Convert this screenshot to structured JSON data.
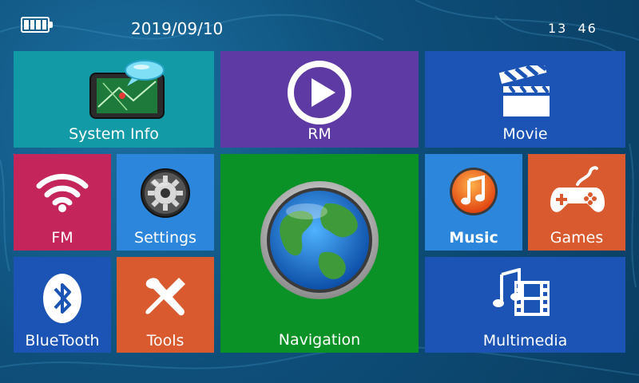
{
  "status_bar": {
    "date": "2019/09/10",
    "time": "13 46",
    "battery_icon": "battery-full-icon"
  },
  "tiles": {
    "system_info": {
      "label": "System Info",
      "icon": "gps-device-icon",
      "color": "#139aa7"
    },
    "rm": {
      "label": "RM",
      "icon": "play-icon",
      "color": "#5e3aa4"
    },
    "movie": {
      "label": "Movie",
      "icon": "clapperboard-icon",
      "color": "#1b54b4"
    },
    "fm": {
      "label": "FM",
      "icon": "wifi-icon",
      "color": "#c4265c"
    },
    "settings": {
      "label": "Settings",
      "icon": "gear-icon",
      "color": "#2b86dc"
    },
    "navigation": {
      "label": "Navigation",
      "icon": "globe-icon",
      "color": "#0a9226"
    },
    "music": {
      "label": "Music",
      "icon": "music-note-icon",
      "color": "#2b86dc"
    },
    "games": {
      "label": "Games",
      "icon": "gamepad-icon",
      "color": "#d95a2e"
    },
    "bluetooth": {
      "label": "BlueTooth",
      "icon": "bluetooth-icon",
      "color": "#1b54b4"
    },
    "tools": {
      "label": "Tools",
      "icon": "tools-icon",
      "color": "#d95a2e"
    },
    "multimedia": {
      "label": "Multimedia",
      "icon": "multimedia-icon",
      "color": "#1b54b4"
    }
  }
}
